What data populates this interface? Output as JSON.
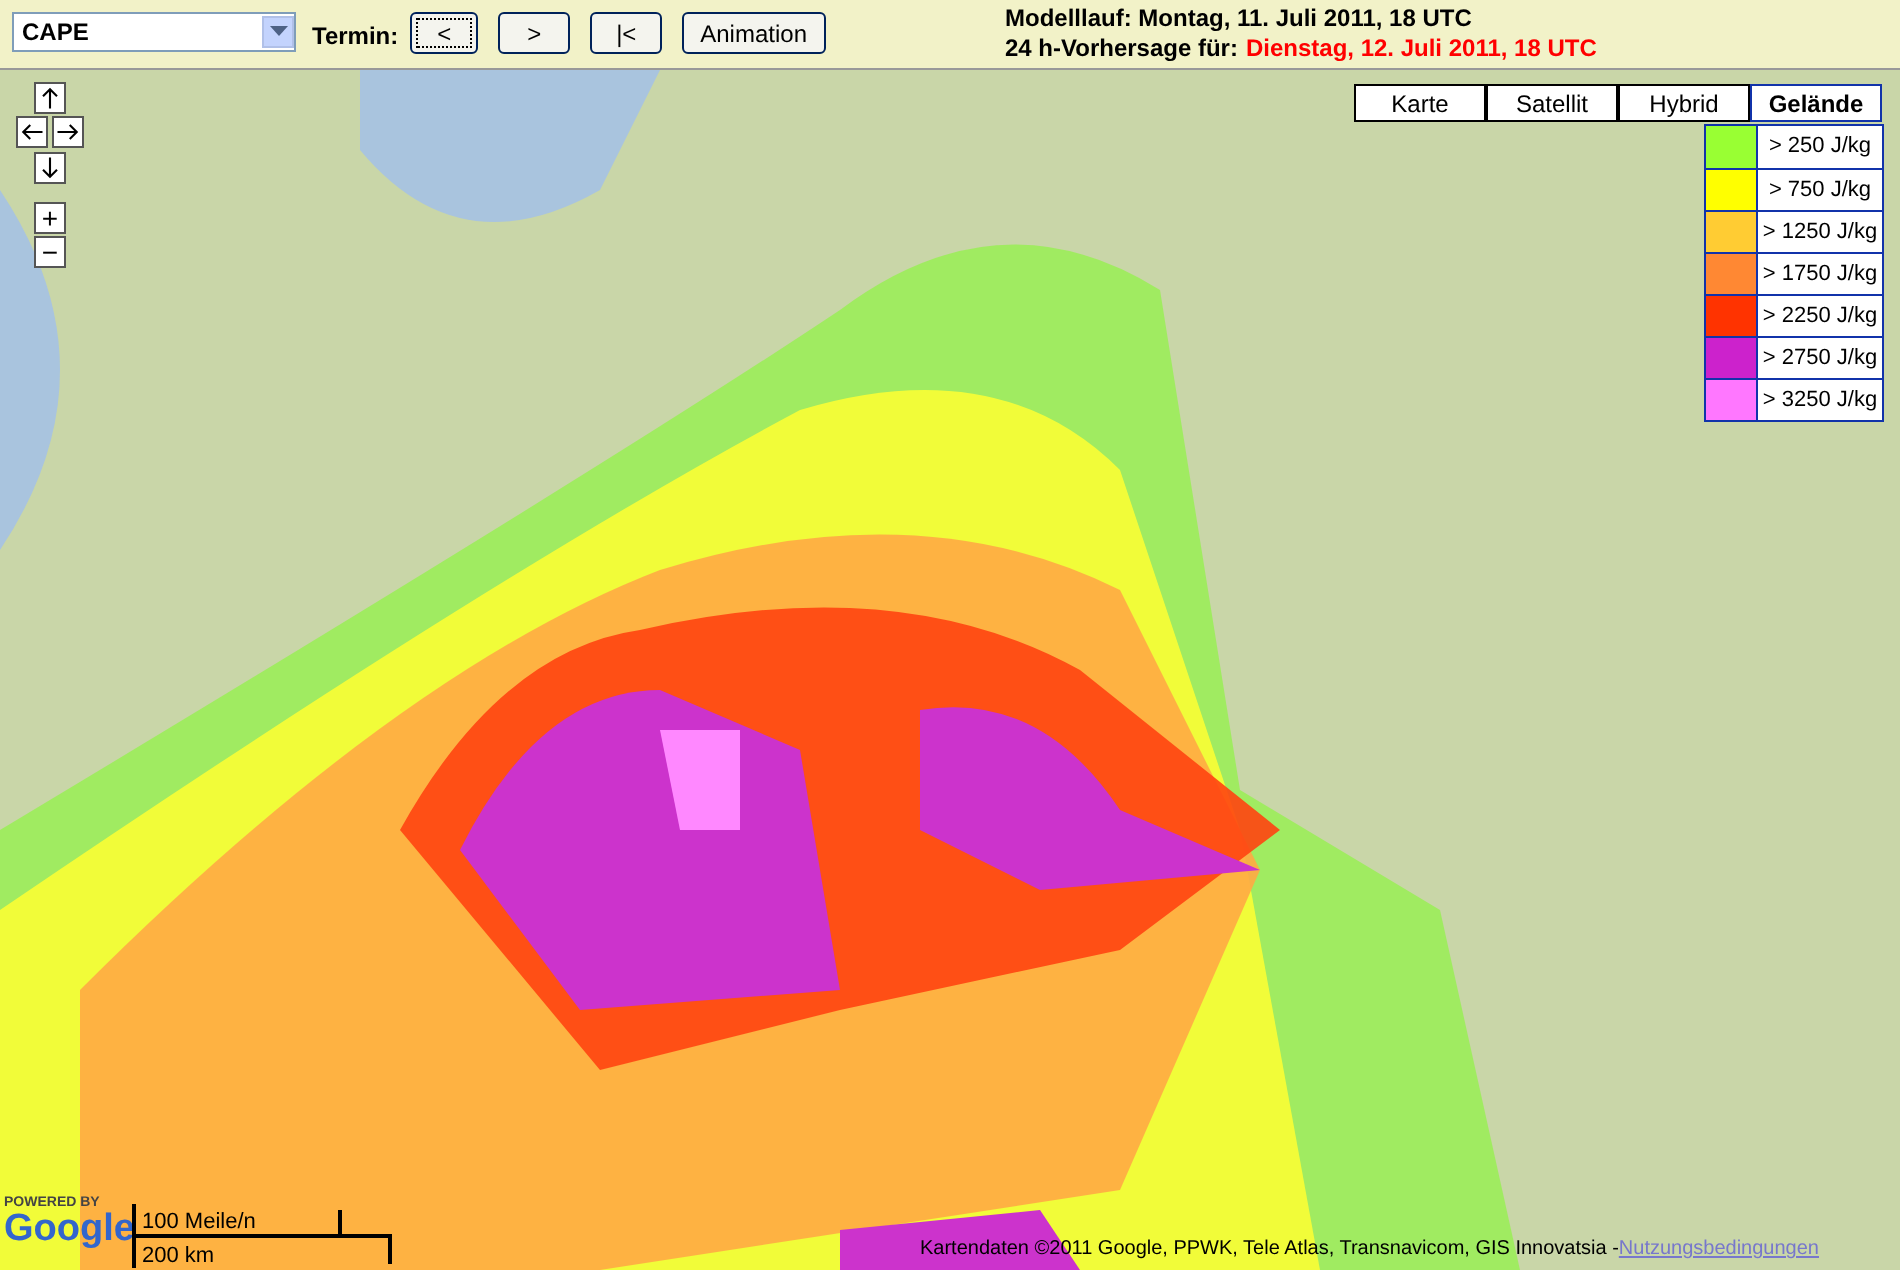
{
  "toolbar": {
    "parameter_select": {
      "value": "CAPE"
    },
    "termin_label": "Termin:",
    "buttons": [
      {
        "label": "<",
        "selected": true
      },
      {
        "label": ">",
        "selected": false
      },
      {
        "label": "|<",
        "selected": false
      },
      {
        "label": "Animation",
        "selected": false
      }
    ],
    "model_run": "Modelllauf: Montag, 11. Juli 2011, 18 UTC",
    "forecast_label": "24 h-Vorhersage für:",
    "forecast_time": "Dienstag, 12. Juli 2011, 18 UTC"
  },
  "map": {
    "zoom_controls": [
      "+",
      "−"
    ],
    "map_types": [
      {
        "label": "Karte",
        "selected": false
      },
      {
        "label": "Satellit",
        "selected": false
      },
      {
        "label": "Hybrid",
        "selected": false
      },
      {
        "label": "Gelände",
        "selected": true
      }
    ],
    "legend": [
      {
        "color": "#99ff33",
        "label": "> 250 J/kg"
      },
      {
        "color": "#ffff00",
        "label": "> 750 J/kg"
      },
      {
        "color": "#ffcc33",
        "label": "> 1250 J/kg"
      },
      {
        "color": "#ff8833",
        "label": "> 1750 J/kg"
      },
      {
        "color": "#ff3300",
        "label": "> 2250 J/kg"
      },
      {
        "color": "#cc22cc",
        "label": "> 2750 J/kg"
      },
      {
        "color": "#ff77ff",
        "label": "> 3250 J/kg"
      }
    ],
    "logo": {
      "powered_by": "POWERED BY",
      "name": "Google"
    },
    "scale": {
      "miles": "100 Meile/n",
      "km": "200 km"
    },
    "attribution": "Kartendaten ©2011 Google, PPWK, Tele Atlas, Transnavicom, GIS Innovatsia - ",
    "terms_link": "Nutzungsbedingungen"
  }
}
